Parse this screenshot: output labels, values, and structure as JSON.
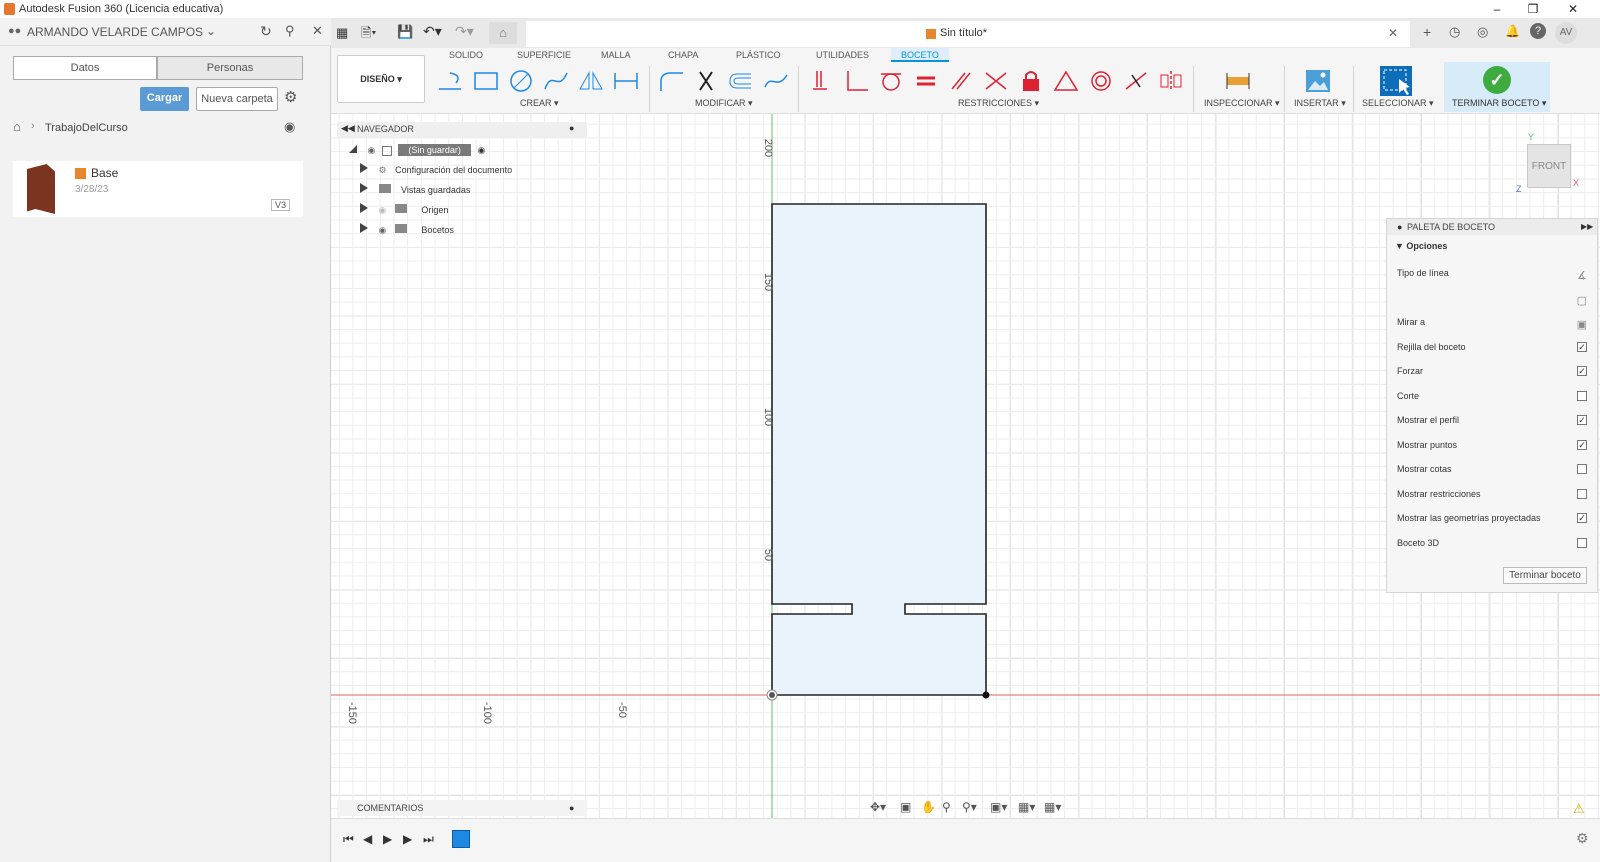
{
  "window": {
    "title": "Autodesk Fusion 360 (Licencia educativa)"
  },
  "user": {
    "name": "ARMANDO VELARDE CAMPOS"
  },
  "data_panel": {
    "tabs": [
      "Datos",
      "Personas"
    ],
    "upload_label": "Cargar",
    "new_folder_label": "Nueva carpeta",
    "breadcrumb": "TrabajoDelCurso",
    "file": {
      "name": "Base",
      "date": "3/28/23",
      "version": "V3"
    }
  },
  "document": {
    "tab_title": "Sin título*",
    "user_initials": "AV"
  },
  "workspace_tabs": [
    "SOLIDO",
    "SUPERFICIE",
    "MALLA",
    "CHAPA",
    "PLÁSTICO",
    "UTILIDADES",
    "BOCETO"
  ],
  "active_workspace_tab": "BOCETO",
  "workspace_switch": "DISEÑO",
  "tool_groups": {
    "crear": "CREAR",
    "modificar": "MODIFICAR",
    "restricciones": "RESTRICCIONES",
    "inspeccionar": "INSPECCIONAR",
    "insertar": "INSERTAR",
    "seleccionar": "SELECCIONAR",
    "terminar": "TERMINAR BOCETO"
  },
  "browser": {
    "title": "NAVEGADOR",
    "root": "(Sin guardar)",
    "items": [
      "Configuración del documento",
      "Vistas guardadas",
      "Origen",
      "Bocetos"
    ]
  },
  "viewcube": {
    "label": "FRONT",
    "axes": [
      "Y",
      "X",
      "Z"
    ]
  },
  "axis_labels": {
    "v": [
      "200",
      "150",
      "100",
      "50"
    ],
    "h": [
      "-150",
      "-100",
      "-50"
    ]
  },
  "palette": {
    "title": "PALETA DE BOCETO",
    "section": "Opciones",
    "rows": [
      {
        "label": "Tipo de línea",
        "kind": "icon"
      },
      {
        "label": "",
        "kind": "icon"
      },
      {
        "label": "Mirar a",
        "kind": "icon"
      },
      {
        "label": "Rejilla del boceto",
        "checked": true
      },
      {
        "label": "Forzar",
        "checked": true
      },
      {
        "label": "Corte",
        "checked": false
      },
      {
        "label": "Mostrar el perfil",
        "checked": true
      },
      {
        "label": "Mostrar puntos",
        "checked": true
      },
      {
        "label": "Mostrar cotas",
        "checked": false
      },
      {
        "label": "Mostrar restricciones",
        "checked": false
      },
      {
        "label": "Mostrar las geometrías proyectadas",
        "checked": true
      },
      {
        "label": "Boceto 3D",
        "checked": false
      }
    ],
    "finish_button": "Terminar boceto"
  },
  "comments": {
    "title": "COMENTARIOS"
  },
  "colors": {
    "accent": "#0696d7",
    "ok_green": "#3dab3d",
    "sketch_fill": "#e8f3fc",
    "x_axis": "#e06060",
    "y_axis": "#5fc25f"
  }
}
